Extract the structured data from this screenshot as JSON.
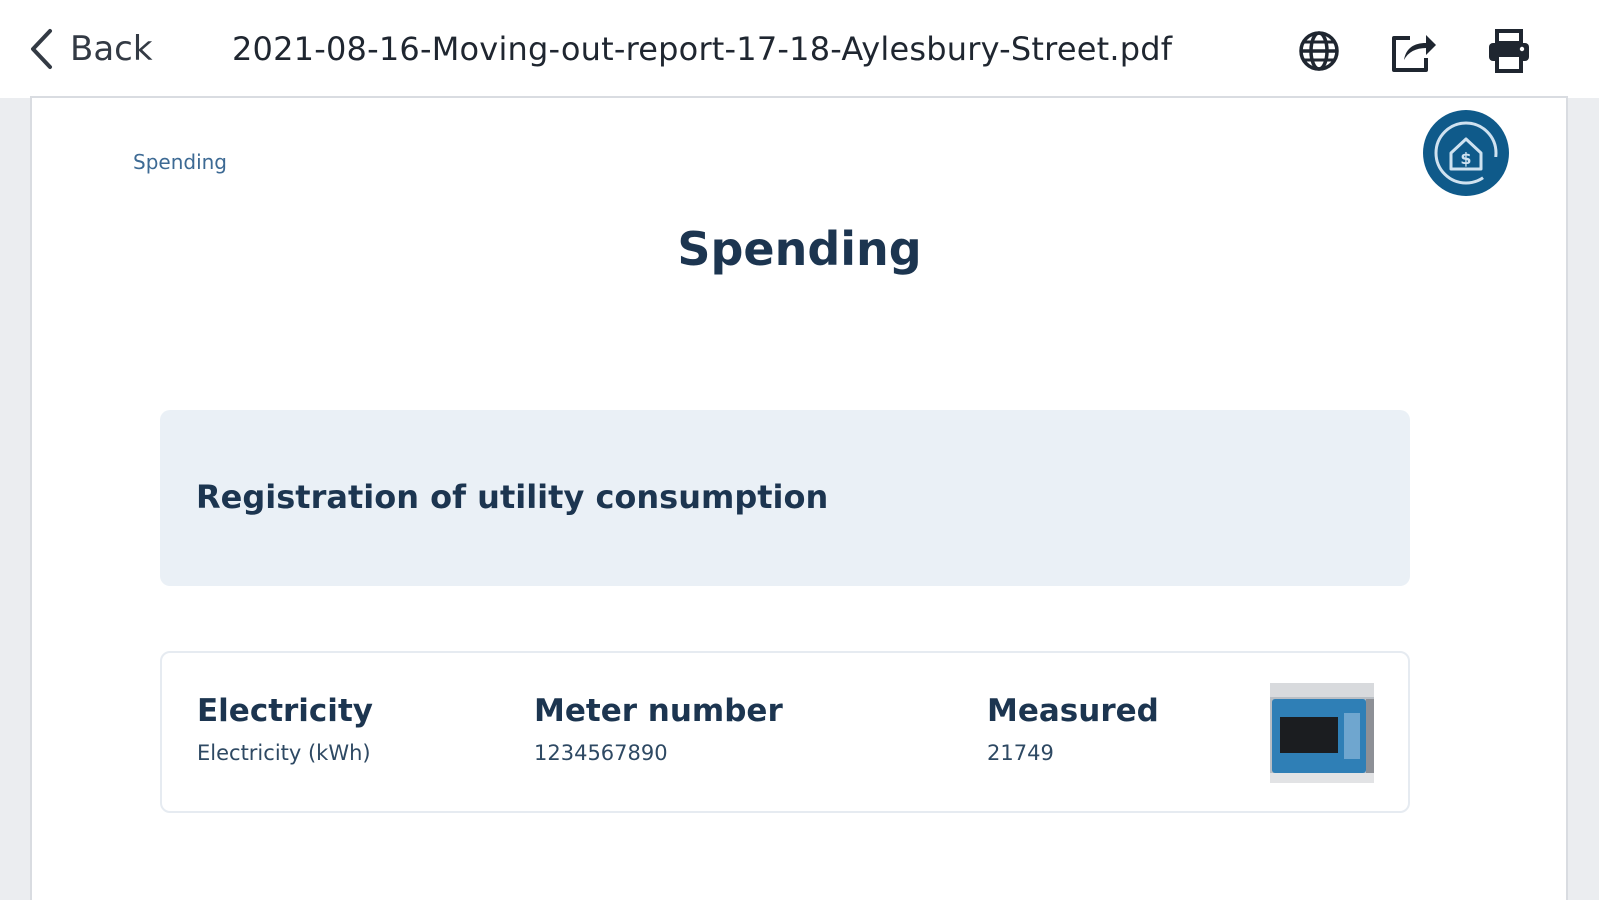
{
  "toolbar": {
    "back_label": "Back",
    "document_title": "2021-08-16-Moving-out-report-17-18-Aylesbury-Street.pdf",
    "icons": [
      "chevron-left-icon",
      "globe-icon",
      "share-icon",
      "print-icon"
    ]
  },
  "page": {
    "breadcrumb": "Spending",
    "title": "Spending",
    "section_title": "Registration of utility consumption",
    "meter": {
      "type_label": "Electricity",
      "type_detail": "Electricity (kWh)",
      "meter_number_label": "Meter number",
      "meter_number_value": "1234567890",
      "measured_label": "Measured",
      "measured_value": "21749"
    }
  },
  "colors": {
    "brand": "#0f5a8a",
    "title_text": "#1c3550",
    "section_bg": "#eaf0f6",
    "breadcrumb": "#3d6a94"
  }
}
